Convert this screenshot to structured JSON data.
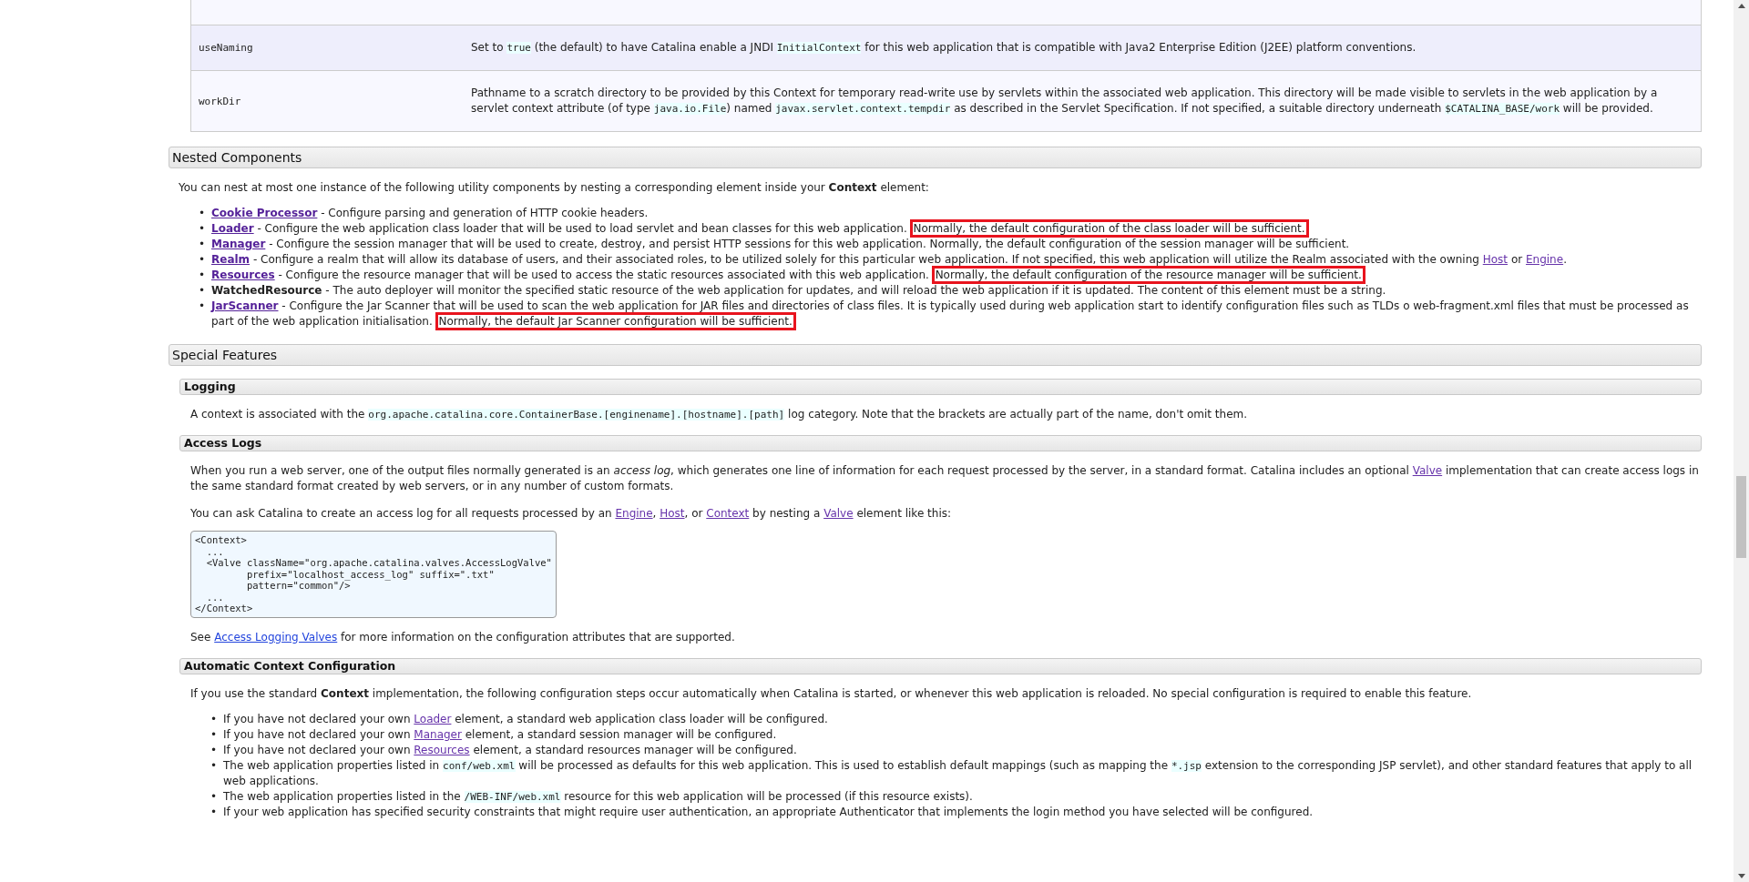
{
  "table": {
    "rows": [
      {
        "name": "useNaming",
        "description": [
          {
            "kind": "text",
            "text": "Set to "
          },
          {
            "kind": "code",
            "text": "true"
          },
          {
            "kind": "text",
            "text": " (the default) to have Catalina enable a JNDI "
          },
          {
            "kind": "code",
            "text": "InitialContext"
          },
          {
            "kind": "text",
            "text": " for this web application that is compatible with Java2 Enterprise Edition (J2EE) platform conventions."
          }
        ]
      },
      {
        "name": "workDir",
        "description": [
          {
            "kind": "text",
            "text": "Pathname to a scratch directory to be provided by this Context for temporary read-write use by servlets within the associated web application. This directory will be made visible to servlets in the web application by a servlet context attribute (of type "
          },
          {
            "kind": "code",
            "text": "java.io.File"
          },
          {
            "kind": "text",
            "text": ") named "
          },
          {
            "kind": "code",
            "text": "javax.servlet.context.tempdir"
          },
          {
            "kind": "text",
            "text": " as described in the Servlet Specification. If not specified, a suitable directory underneath "
          },
          {
            "kind": "code",
            "text": "$CATALINA_BASE/work"
          },
          {
            "kind": "text",
            "text": " will be provided."
          }
        ]
      }
    ]
  },
  "sections": [
    {
      "title": "Nested Components",
      "blocks": [
        {
          "kind": "para",
          "segments": [
            {
              "kind": "text",
              "text": "You can nest at most one instance of the following utility components by nesting a corresponding element inside your "
            },
            {
              "kind": "strong",
              "text": "Context"
            },
            {
              "kind": "text",
              "text": " element:"
            }
          ]
        },
        {
          "kind": "list",
          "marker": "•",
          "items": [
            [
              {
                "kind": "strong-link",
                "text": "Cookie Processor"
              },
              {
                "kind": "text",
                "text": " - Configure parsing and generation of HTTP cookie headers."
              }
            ],
            [
              {
                "kind": "strong-link",
                "text": "Loader"
              },
              {
                "kind": "text",
                "text": " - Configure the web application class loader that will be used to load servlet and bean classes for this web application. "
              },
              {
                "kind": "boxed",
                "text": "Normally, the default configuration of the class loader will be sufficient."
              }
            ],
            [
              {
                "kind": "strong-link",
                "text": "Manager"
              },
              {
                "kind": "text",
                "text": " - Configure the session manager that will be used to create, destroy, and persist HTTP sessions for this web application. Normally, the default configuration of the session manager will be sufficient."
              }
            ],
            [
              {
                "kind": "strong-link",
                "text": "Realm"
              },
              {
                "kind": "text",
                "text": " - Configure a realm that will allow its database of users, and their associated roles, to be utilized solely for this particular web application. If not specified, this web application will utilize the Realm associated with the owning "
              },
              {
                "kind": "link",
                "text": "Host"
              },
              {
                "kind": "text",
                "text": " or "
              },
              {
                "kind": "link",
                "text": "Engine"
              },
              {
                "kind": "text",
                "text": "."
              }
            ],
            [
              {
                "kind": "strong-link",
                "text": "Resources"
              },
              {
                "kind": "text",
                "text": " - Configure the resource manager that will be used to access the static resources associated with this web application. "
              },
              {
                "kind": "boxed",
                "text": "Normally, the default configuration of the resource manager will be sufficient."
              }
            ],
            [
              {
                "kind": "strong",
                "text": "WatchedResource"
              },
              {
                "kind": "text",
                "text": " - The auto deployer will monitor the specified static resource of the web application for updates, and will reload the web application if it is updated. The content of this element must be a string."
              }
            ],
            [
              {
                "kind": "strong-link",
                "text": "JarScanner"
              },
              {
                "kind": "text",
                "text": " - Configure the Jar Scanner that will be used to scan the web application for JAR files and directories of class files. It is typically used during web application start to identify configuration files such as TLDs o web-fragment.xml files that must be processed as part of the web application initialisation. "
              },
              {
                "kind": "boxed",
                "text": "Normally, the default Jar Scanner configuration will be sufficient."
              }
            ]
          ]
        }
      ]
    },
    {
      "title": "Special Features",
      "subsections": [
        {
          "title": "Logging",
          "blocks": [
            {
              "kind": "para",
              "segments": [
                {
                  "kind": "text",
                  "text": "A context is associated with the "
                },
                {
                  "kind": "code",
                  "text": "org.apache.catalina.core.ContainerBase.[enginename].[hostname].[path]"
                },
                {
                  "kind": "text",
                  "text": " log category. Note that the brackets are actually part of the name, don't omit them."
                }
              ]
            }
          ]
        },
        {
          "title": "Access Logs",
          "blocks": [
            {
              "kind": "para",
              "segments": [
                {
                  "kind": "text",
                  "text": "When you run a web server, one of the output files normally generated is an "
                },
                {
                  "kind": "em",
                  "text": "access log"
                },
                {
                  "kind": "text",
                  "text": ", which generates one line of information for each request processed by the server, in a standard format. Catalina includes an optional "
                },
                {
                  "kind": "link",
                  "text": "Valve"
                },
                {
                  "kind": "text",
                  "text": " implementation that can create access logs in the same standard format created by web servers, or in any number of custom formats."
                }
              ]
            },
            {
              "kind": "para",
              "segments": [
                {
                  "kind": "text",
                  "text": "You can ask Catalina to create an access log for all requests processed by an "
                },
                {
                  "kind": "link",
                  "text": "Engine"
                },
                {
                  "kind": "text",
                  "text": ", "
                },
                {
                  "kind": "link",
                  "text": "Host"
                },
                {
                  "kind": "text",
                  "text": ", or "
                },
                {
                  "kind": "link",
                  "text": "Context"
                },
                {
                  "kind": "text",
                  "text": " by nesting a "
                },
                {
                  "kind": "link",
                  "text": "Valve"
                },
                {
                  "kind": "text",
                  "text": " element like this:"
                }
              ]
            },
            {
              "kind": "code",
              "text": "<Context>\n  ...\n  <Valve className=\"org.apache.catalina.valves.AccessLogValve\"\n         prefix=\"localhost_access_log\" suffix=\".txt\"\n         pattern=\"common\"/>\n  ...\n</Context>"
            },
            {
              "kind": "para",
              "segments": [
                {
                  "kind": "text",
                  "text": "See "
                },
                {
                  "kind": "new-link",
                  "text": "Access Logging Valves"
                },
                {
                  "kind": "text",
                  "text": " for more information on the configuration attributes that are supported."
                }
              ]
            }
          ]
        },
        {
          "title": "Automatic Context Configuration",
          "blocks": [
            {
              "kind": "para",
              "segments": [
                {
                  "kind": "text",
                  "text": "If you use the standard "
                },
                {
                  "kind": "strong",
                  "text": "Context"
                },
                {
                  "kind": "text",
                  "text": " implementation, the following configuration steps occur automatically when Catalina is started, or whenever this web application is reloaded. No special configuration is required to enable this feature."
                }
              ]
            },
            {
              "kind": "list",
              "marker": "•",
              "items": [
                [
                  {
                    "kind": "text",
                    "text": "If you have not declared your own "
                  },
                  {
                    "kind": "link",
                    "text": "Loader"
                  },
                  {
                    "kind": "text",
                    "text": " element, a standard web application class loader will be configured."
                  }
                ],
                [
                  {
                    "kind": "text",
                    "text": "If you have not declared your own "
                  },
                  {
                    "kind": "link",
                    "text": "Manager"
                  },
                  {
                    "kind": "text",
                    "text": " element, a standard session manager will be configured."
                  }
                ],
                [
                  {
                    "kind": "text",
                    "text": "If you have not declared your own "
                  },
                  {
                    "kind": "link",
                    "text": "Resources"
                  },
                  {
                    "kind": "text",
                    "text": " element, a standard resources manager will be configured."
                  }
                ],
                [
                  {
                    "kind": "text",
                    "text": "The web application properties listed in "
                  },
                  {
                    "kind": "code",
                    "text": "conf/web.xml"
                  },
                  {
                    "kind": "text",
                    "text": " will be processed as defaults for this web application. This is used to establish default mappings (such as mapping the "
                  },
                  {
                    "kind": "code",
                    "text": "*.jsp"
                  },
                  {
                    "kind": "text",
                    "text": " extension to the corresponding JSP servlet), and other standard features that apply to all web applications."
                  }
                ],
                [
                  {
                    "kind": "text",
                    "text": "The web application properties listed in the "
                  },
                  {
                    "kind": "code",
                    "text": "/WEB-INF/web.xml"
                  },
                  {
                    "kind": "text",
                    "text": " resource for this web application will be processed (if this resource exists)."
                  }
                ],
                [
                  {
                    "kind": "text",
                    "text": "If your web application has specified security constraints that might require user authentication, an appropriate Authenticator that implements the login method you have selected will be configured."
                  }
                ]
              ]
            }
          ]
        }
      ]
    }
  ]
}
